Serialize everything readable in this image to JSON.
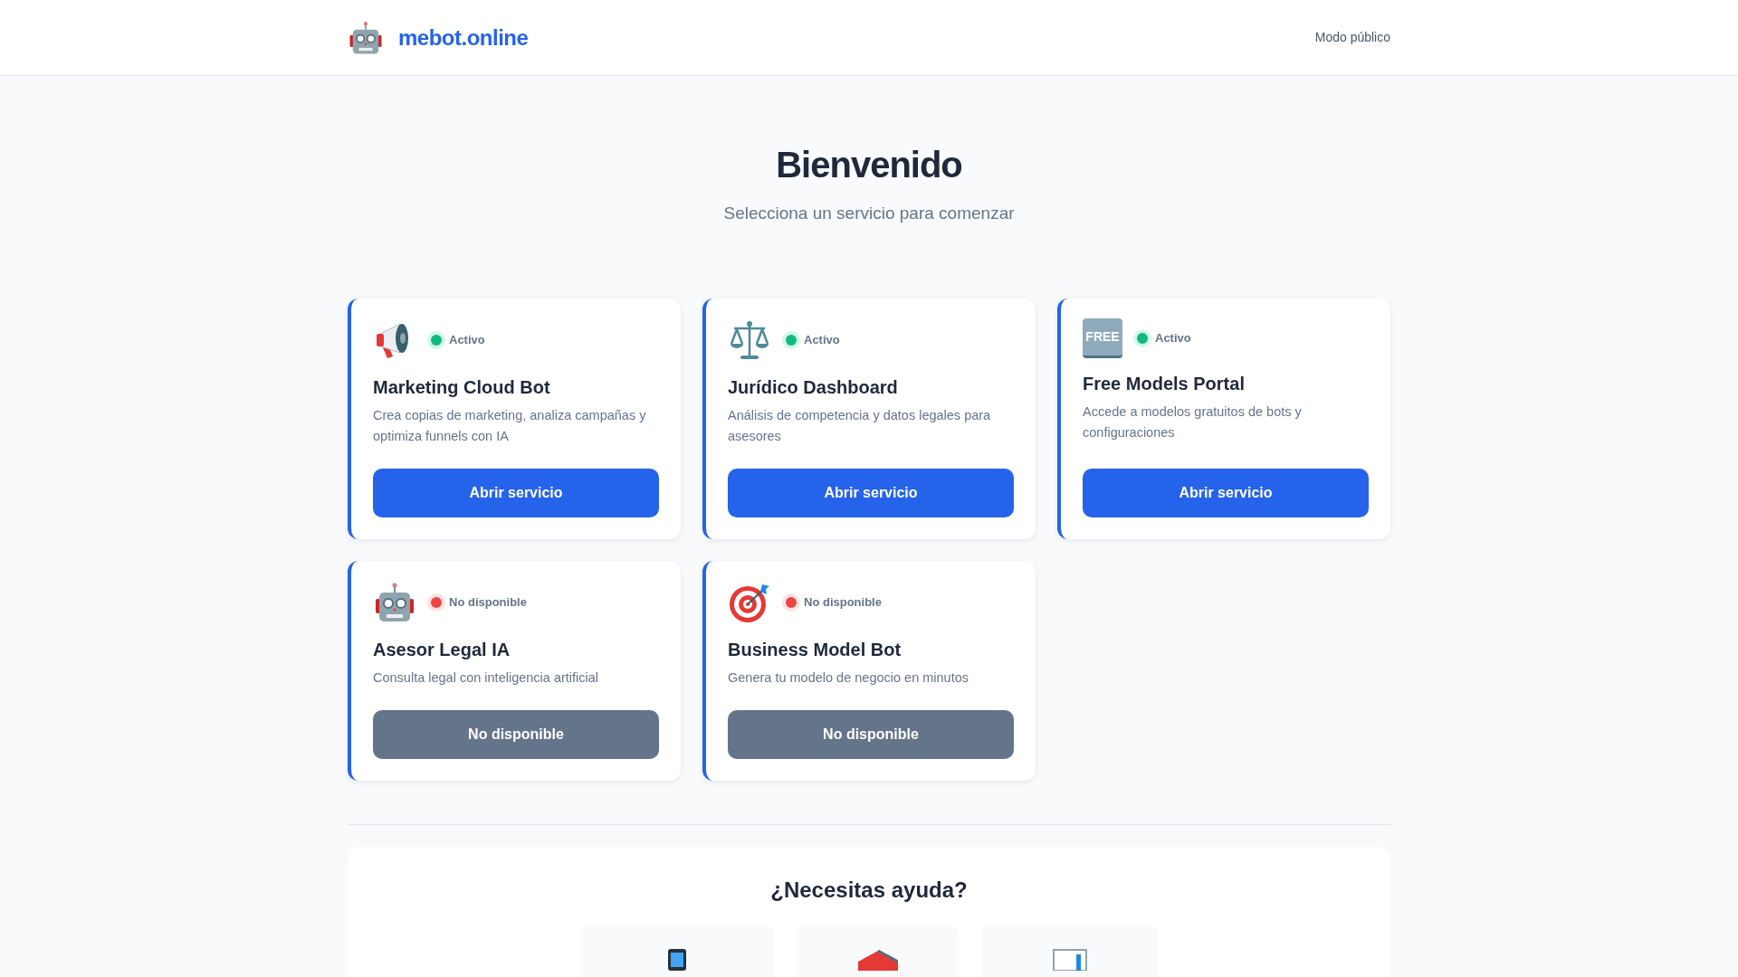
{
  "brand": {
    "name": "mebot.online"
  },
  "nav_link": "Modo público",
  "heading": "Bienvenido",
  "subtitle": "Selecciona un servicio para comenzar",
  "services": [
    {
      "kind": "megaphone",
      "active": true,
      "status": "Activo",
      "name": "Marketing Cloud Bot",
      "description": "Crea copias de marketing, analiza campañas y optimiza funnels con IA",
      "button": "Abrir servicio"
    },
    {
      "kind": "scales",
      "active": true,
      "status": "Activo",
      "name": "Jurídico Dashboard",
      "description": "Análisis de competencia y datos legales para asesores",
      "button": "Abrir servicio"
    },
    {
      "kind": "badge",
      "badge_text": "FREE",
      "active": true,
      "status": "Activo",
      "name": "Free Models Portal",
      "description": "Accede a modelos gratuitos de bots y configuraciones",
      "button": "Abrir servicio"
    },
    {
      "kind": "robot",
      "active": false,
      "status": "No disponible",
      "name": "Asesor Legal IA",
      "description": "Consulta legal con inteligencia artificial",
      "button": "No disponible"
    },
    {
      "kind": "target",
      "active": false,
      "status": "No disponible",
      "name": "Business Model Bot",
      "description": "Genera tu modelo de negocio en minutos",
      "button": "No disponible"
    }
  ],
  "help": {
    "title": "¿Necesitas ayuda?",
    "options": [
      {
        "kind": "phone"
      },
      {
        "kind": "book"
      },
      {
        "kind": "chart"
      }
    ]
  }
}
